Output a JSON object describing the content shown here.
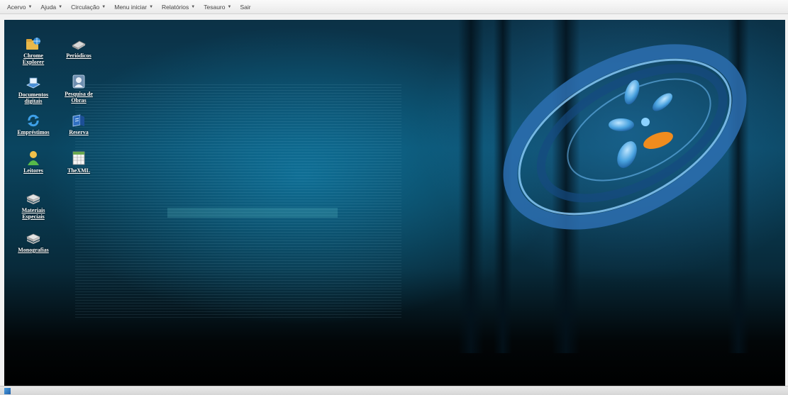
{
  "menu": {
    "items": [
      {
        "label": "Acervo"
      },
      {
        "label": "Ajuda"
      },
      {
        "label": "Circulação"
      },
      {
        "label": "Menu iniciar"
      },
      {
        "label": "Relatórios"
      },
      {
        "label": "Tesauro"
      },
      {
        "label": "Sair"
      }
    ]
  },
  "desktop": {
    "icons": [
      {
        "label": "Chrome Explorer",
        "icon": "folder-globe-icon"
      },
      {
        "label": "Periódicos",
        "icon": "books-icon"
      },
      {
        "label": "Documentos digitais",
        "icon": "digital-document-icon"
      },
      {
        "label": "Pesquisa de Obras",
        "icon": "search-person-icon"
      },
      {
        "label": "Empréstimos",
        "icon": "refresh-arrows-icon"
      },
      {
        "label": "Reserva",
        "icon": "reserve-book-icon"
      },
      {
        "label": "Leitores",
        "icon": "user-icon"
      },
      {
        "label": "TheXML",
        "icon": "spreadsheet-icon"
      },
      {
        "label": "Materiais Especiais",
        "icon": "stacked-books-icon"
      },
      {
        "label": "Monografias",
        "icon": "stacked-books-icon"
      }
    ]
  },
  "colors": {
    "label_text": "#ffffff",
    "desktop_top": "#0b3146",
    "desktop_glow": "#1496c8",
    "logo_orange": "#f08c1e"
  }
}
